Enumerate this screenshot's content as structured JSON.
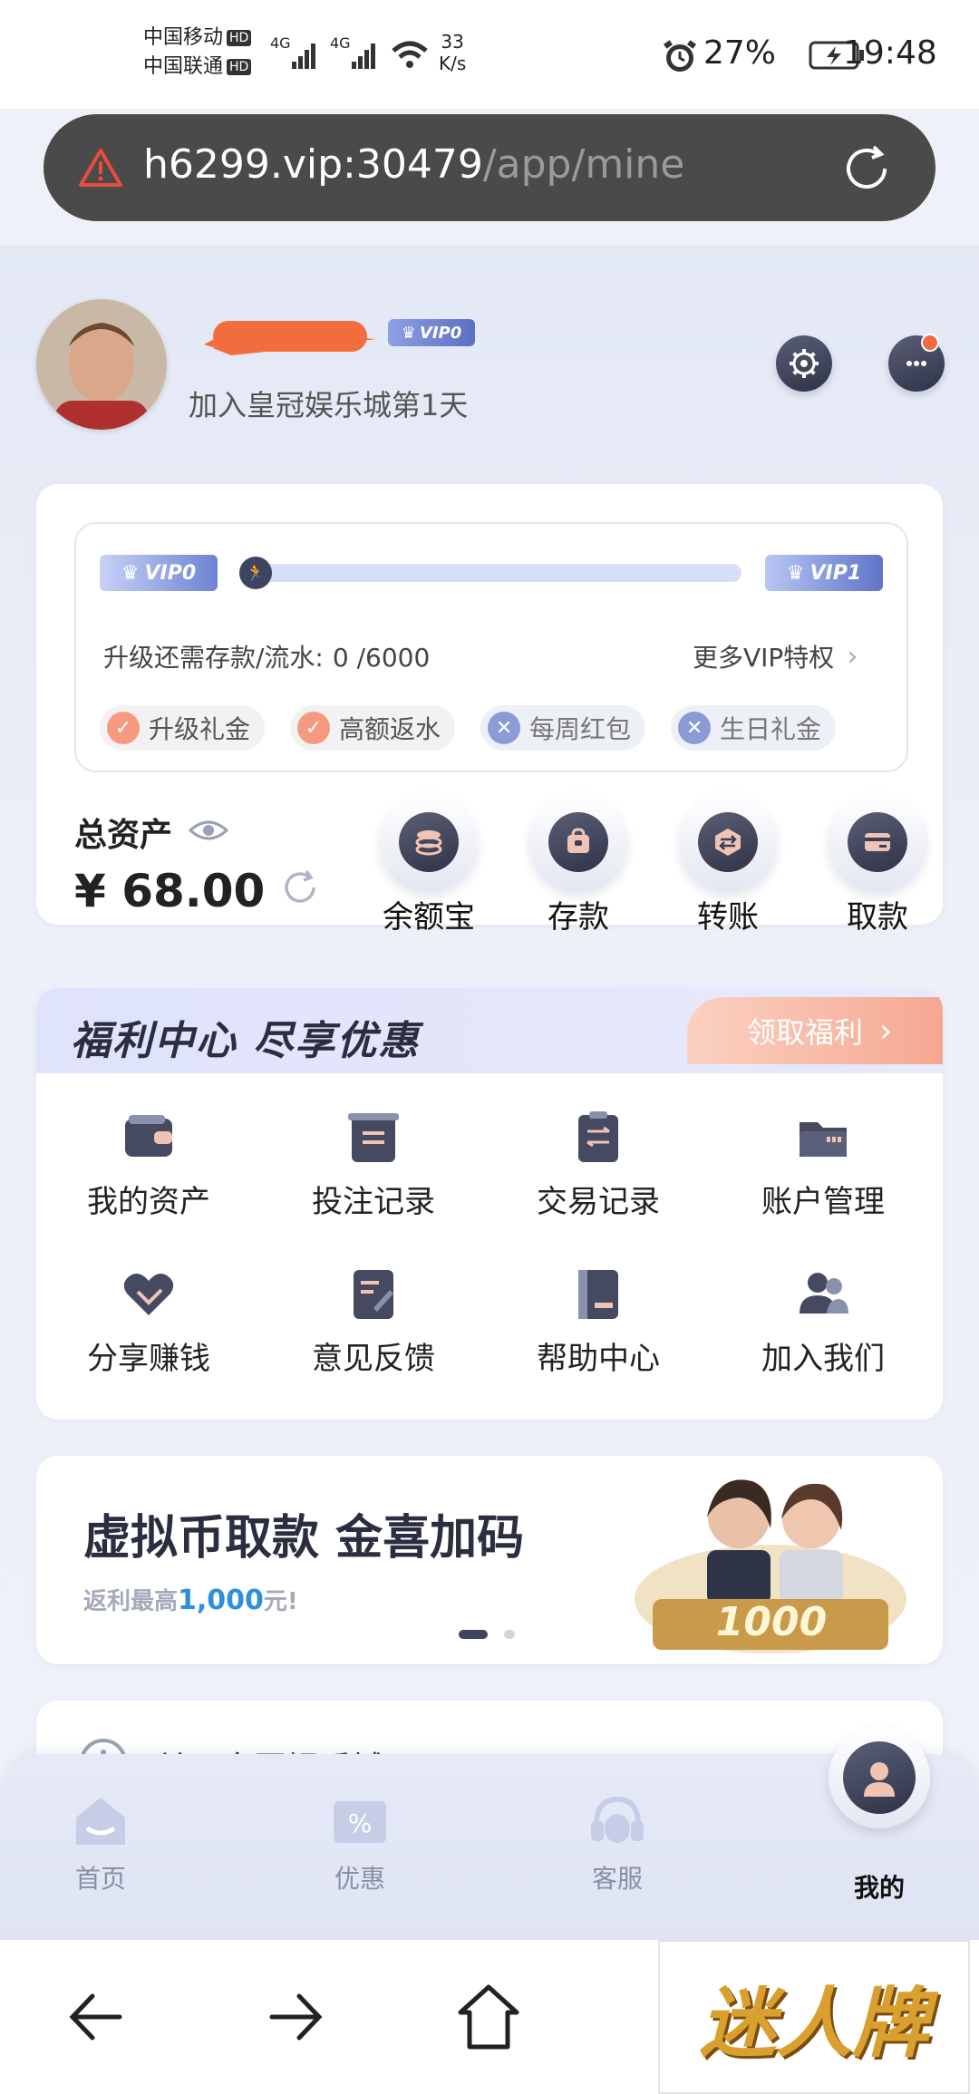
{
  "status_bar": {
    "carrier1": "中国移动",
    "carrier2": "中国联通",
    "hd": "HD",
    "net1": "4G",
    "net2": "4G",
    "speed_value": "33",
    "speed_unit": "K/s",
    "battery": "27%",
    "time": "19:48"
  },
  "browser": {
    "url_host": "h6299.vip:30479",
    "url_path": "/app/mine"
  },
  "profile": {
    "vip_badge": "VIP0",
    "join_text": "加入皇冠娱乐城第1天"
  },
  "vip_card": {
    "current_level": "VIP0",
    "next_level": "VIP1",
    "progress": 0.0,
    "upgrade_label": "升级还需存款/流水:",
    "upgrade_value": "0 /6000",
    "more_link": "更多VIP特权",
    "perks": [
      {
        "label": "升级礼金",
        "unlocked": true
      },
      {
        "label": "高额返水",
        "unlocked": true
      },
      {
        "label": "每周红包",
        "unlocked": false
      },
      {
        "label": "生日礼金",
        "unlocked": false
      }
    ]
  },
  "assets": {
    "title": "总资产",
    "amount": "¥ 68.00",
    "actions": [
      {
        "label": "余额宝",
        "icon": "coin-stack-icon"
      },
      {
        "label": "存款",
        "icon": "wallet-bag-icon"
      },
      {
        "label": "转账",
        "icon": "transfer-icon"
      },
      {
        "label": "取款",
        "icon": "card-icon"
      }
    ]
  },
  "welfare": {
    "title": "福利中心 尽享优惠",
    "claim_label": "领取福利",
    "items": [
      {
        "label": "我的资产",
        "icon": "wallet-icon"
      },
      {
        "label": "投注记录",
        "icon": "bet-record-icon"
      },
      {
        "label": "交易记录",
        "icon": "transaction-record-icon"
      },
      {
        "label": "账户管理",
        "icon": "folder-icon"
      },
      {
        "label": "分享赚钱",
        "icon": "handshake-icon"
      },
      {
        "label": "意见反馈",
        "icon": "feedback-icon"
      },
      {
        "label": "帮助中心",
        "icon": "help-book-icon"
      },
      {
        "label": "加入我们",
        "icon": "people-icon"
      }
    ]
  },
  "banner": {
    "title": "虚拟币取款 金喜加码",
    "subtitle_prefix": "返利最高",
    "subtitle_amount": "1,000",
    "subtitle_suffix": "元!",
    "slide_index": 0,
    "slide_count": 2,
    "art_text": "1000"
  },
  "about": {
    "label": "关于皇冠娱乐城"
  },
  "tabbar": [
    {
      "label": "首页",
      "icon": "home-icon",
      "active": false
    },
    {
      "label": "优惠",
      "icon": "discount-icon",
      "active": false
    },
    {
      "label": "客服",
      "icon": "headset-icon",
      "active": false
    },
    {
      "label": "我的",
      "icon": "user-icon",
      "active": true
    }
  ],
  "watermark": "迷人牌",
  "colors": {
    "accent_orange": "#f08a6c",
    "vip_blue": "#7b8fd6",
    "page_bg": "#eef1f8",
    "banner_link_blue": "#2c8fe0"
  }
}
